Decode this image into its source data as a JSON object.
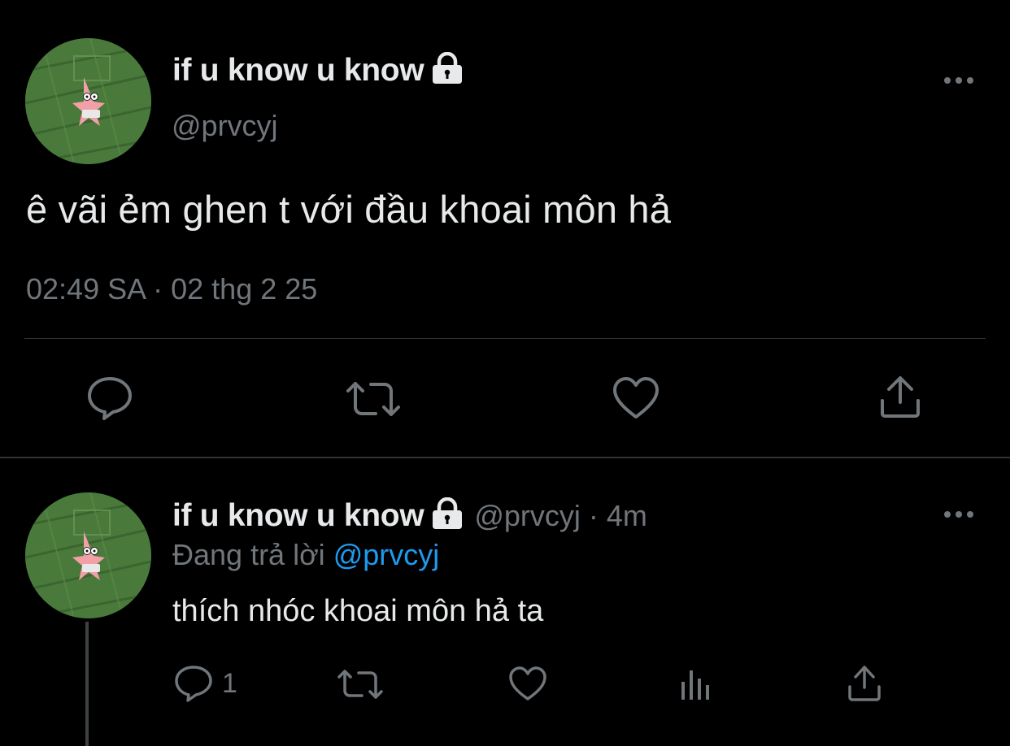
{
  "main_tweet": {
    "display_name": "if u know u know",
    "handle": "@prvcyj",
    "text": "ê vãi ẻm ghen t với đầu khoai môn hả",
    "timestamp": "02:49 SA · 02 thg 2 25",
    "avatar_icon": "patrick-star-avatar",
    "protected_icon": "lock-icon",
    "actions": [
      "reply-icon",
      "retweet-icon",
      "like-icon",
      "share-icon"
    ]
  },
  "reply_tweet": {
    "display_name": "if u know u know",
    "meta": "@prvcyj · 4m",
    "replying_prefix": "Đang trả lời",
    "replying_handle": "@prvcyj",
    "text": "thích nhóc khoai môn hả ta",
    "reply_count": "1",
    "avatar_icon": "patrick-star-avatar",
    "protected_icon": "lock-icon",
    "actions": [
      "reply-icon",
      "retweet-icon",
      "like-icon",
      "analytics-icon",
      "share-icon"
    ]
  },
  "colors": {
    "background": "#000000",
    "primary_text": "#e7e9ea",
    "secondary_text": "#71767b",
    "link": "#1d9bf0",
    "divider": "#2f3336"
  }
}
